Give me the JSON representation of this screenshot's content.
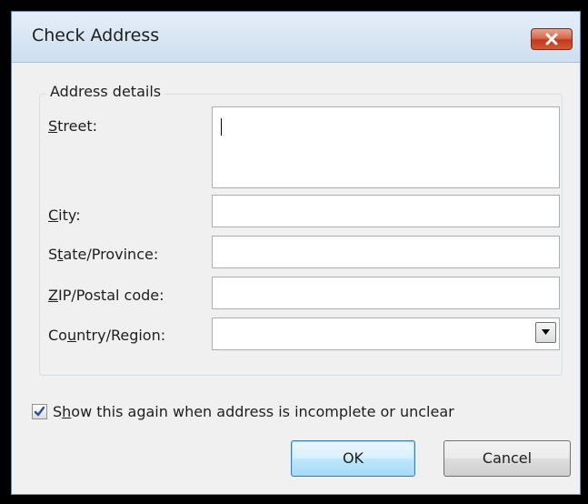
{
  "window": {
    "title": "Check Address"
  },
  "group": {
    "legend": "Address details"
  },
  "fields": {
    "street": {
      "label_access_key": "S",
      "label_rest": "treet:",
      "value": ""
    },
    "city": {
      "label_access_key": "C",
      "label_rest": "ity:",
      "value": ""
    },
    "state": {
      "label_pre": "S",
      "label_access_key": "t",
      "label_rest": "ate/Province:",
      "value": ""
    },
    "zip": {
      "label_access_key": "Z",
      "label_rest": "IP/Postal code:",
      "value": ""
    },
    "country": {
      "label_pre": "Co",
      "label_access_key": "u",
      "label_rest": "ntry/Region:",
      "value": ""
    }
  },
  "checkbox": {
    "checked": true,
    "label_pre": "S",
    "label_access_key": "h",
    "label_rest": "ow this again when address is incomplete or unclear"
  },
  "buttons": {
    "ok_label": "OK",
    "cancel_label": "Cancel"
  },
  "colors": {
    "titlebar": "#dbe8f5",
    "dialog_bg": "#f0f0f0",
    "close_button": "#c9482b",
    "default_button": "#bee6fd"
  },
  "icons": {
    "close": "close-icon",
    "dropdown": "chevron-down-icon",
    "checkmark": "checkmark-icon"
  }
}
